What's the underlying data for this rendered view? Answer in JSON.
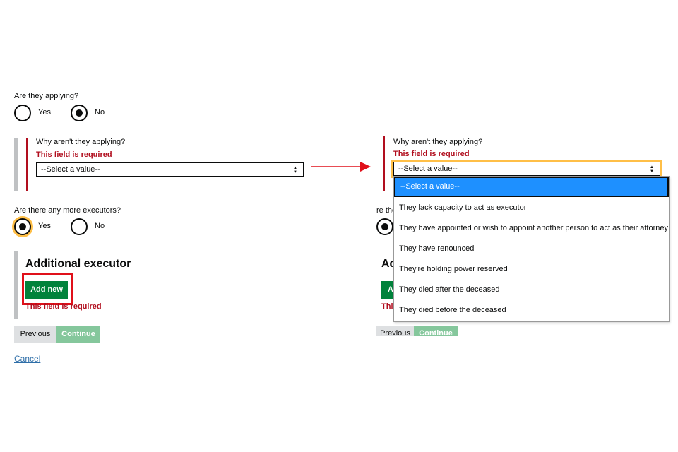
{
  "left": {
    "applying_question": "Are they applying?",
    "applying_options": [
      "Yes",
      "No"
    ],
    "applying_selected": "No",
    "why_label": "Why aren't they applying?",
    "error_text": "This field is required",
    "select_value": "--Select a value--",
    "more_question": "Are there any more executors?",
    "more_options": [
      "Yes",
      "No"
    ],
    "more_selected": "Yes",
    "additional_heading": "Additional executor",
    "add_new_label": "Add new",
    "add_error": "This field is required",
    "previous_label": "Previous",
    "continue_label": "Continue",
    "cancel_label": "Cancel"
  },
  "right": {
    "why_label": "Why aren't they applying?",
    "error_text": "This field is required",
    "select_value": "--Select a value--",
    "options": [
      "--Select a value--",
      "They lack capacity to act as executor",
      "They have appointed or wish to appoint another person to act as their attorney",
      "They have renounced",
      "They're holding power reserved",
      "They died after the deceased",
      "They died before the deceased"
    ],
    "selected_index": 0,
    "partial_more_question": "re the",
    "partial_heading": "Ad",
    "partial_add": "A",
    "partial_error": "Thi",
    "previous_label": "Previous",
    "continue_label": "Continue"
  },
  "colors": {
    "error_red": "#b10e1e",
    "button_green": "#00823b",
    "focus_yellow": "#ffbf47",
    "dropdown_highlight": "#1e90ff",
    "annotation_red": "#e0101a",
    "link_blue": "#2e6ea8"
  },
  "icons": {
    "select_arrows": "▲▼",
    "arrow": "arrow-right-icon"
  }
}
